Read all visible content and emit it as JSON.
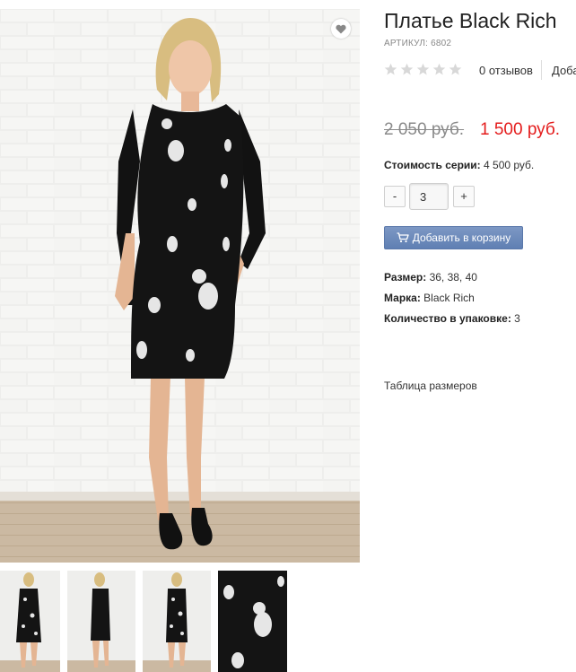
{
  "product": {
    "title": "Платье Black Rich",
    "sku_label": "АРТИКУЛ:",
    "sku_value": "6802",
    "rating": {
      "stars": 0,
      "max": 5,
      "reviews_text": "0 отзывов",
      "add_review_text": "Добавить отзыв"
    },
    "price_old": "2 050 руб.",
    "price_new": "1 500 руб.",
    "series_label": "Стоимость серии:",
    "series_value": "4 500 руб.",
    "quantity": {
      "minus_label": "-",
      "value": "3",
      "plus_label": "+"
    },
    "add_to_cart_label": "Добавить в корзину",
    "properties": [
      {
        "label": "Размер:",
        "value": "36, 38, 40"
      },
      {
        "label": "Марка:",
        "value": "Black Rich"
      },
      {
        "label": "Количество в упаковке:",
        "value": "3"
      }
    ],
    "size_table_link": "Таблица размеров"
  },
  "gallery": {
    "thumbnail_count": 4,
    "active_thumbnail": 0
  },
  "colors": {
    "price_new": "#e41c1c",
    "price_old": "#8a8a8a",
    "cart_button": "#6a88bb",
    "star_empty": "#d8d8d8"
  },
  "icons": {
    "favorite": "heart-icon",
    "cart": "shopping-cart-icon",
    "rating": "star-icon"
  }
}
